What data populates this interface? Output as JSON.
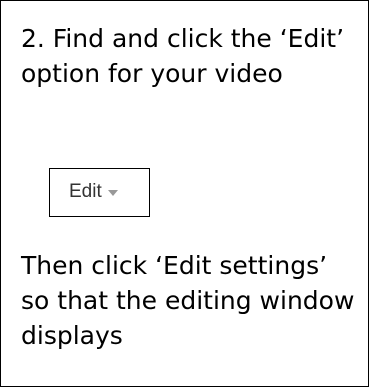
{
  "instruction": {
    "step_intro": "2. Find and click the ‘Edit’ option for your video",
    "step_followup": "Then click ‘Edit settings’ so that the editing window displays"
  },
  "edit_control": {
    "label": "Edit",
    "icon": "caret-down-icon",
    "text_color": "#333333",
    "icon_color": "#999999"
  }
}
